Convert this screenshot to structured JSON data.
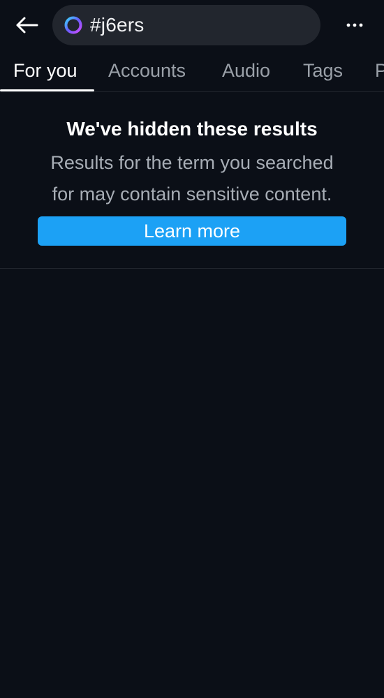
{
  "header": {
    "search_query": "#j6ers",
    "icons": {
      "back": "arrow-left-icon",
      "search_ring": "gradient-ring-icon",
      "more": "more-horizontal-icon"
    }
  },
  "tabs": [
    {
      "label": "For you",
      "active": true
    },
    {
      "label": "Accounts",
      "active": false
    },
    {
      "label": "Audio",
      "active": false
    },
    {
      "label": "Tags",
      "active": false
    },
    {
      "label": "P",
      "active": false
    }
  ],
  "notice": {
    "title": "We've hidden these results",
    "body_line1": "Results for the term you searched",
    "body_line2": "for may contain sensitive content.",
    "button_label": "Learn more"
  },
  "colors": {
    "background": "#0b0f17",
    "search_pill": "#22262e",
    "accent": "#1ca1f5",
    "muted_text": "#a7adb5",
    "divider": "#23272f"
  }
}
